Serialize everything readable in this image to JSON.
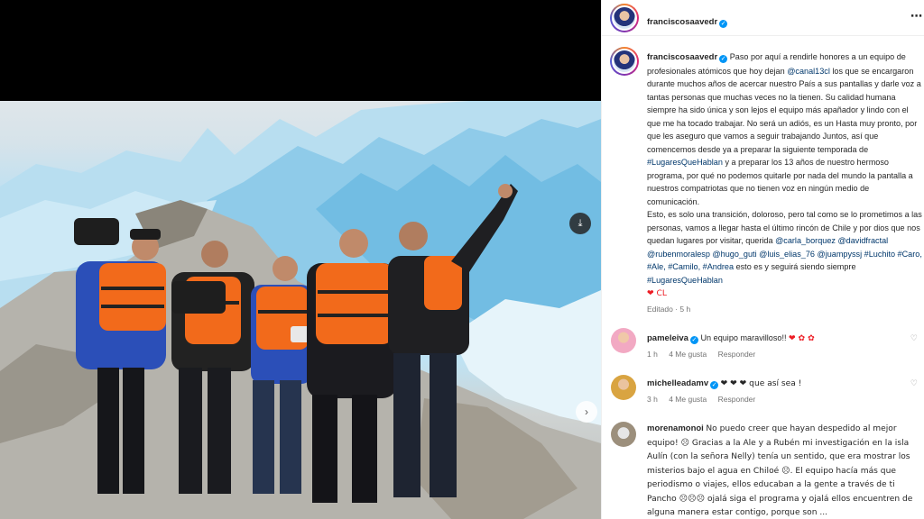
{
  "post": {
    "username": "franciscosaavedr",
    "more_icon": "⋯",
    "caption_parts": {
      "p1a": "Paso por aquí a rendirle honores a un equipo de profesionales atómicos que hoy dejan ",
      "mention_canal": "@canal13cl",
      "p1b": " los que se encargaron durante muchos años de acercar nuestro País a sus pantallas y darle voz a tantas personas que muchas veces no la tienen. Su calidad humana siempre ha sido única y son lejos el equipo más apañador y lindo con el que me ha tocado trabajar. No será un adiós, es un Hasta muy pronto, por que les aseguro que vamos a seguir trabajando Juntos, así que comencemos desde ya a preparar la siguiente temporada de ",
      "hashtag1": "#LugaresQueHablan",
      "p1c": " y a preparar los 13 años de nuestro hermoso programa, por qué no podemos quitarle por nada del mundo la pantalla a nuestros compatriotas que no tienen voz en ningún medio de comunicación.",
      "p2a": "Esto, es solo una transición, doloroso, pero tal como se lo prometimos a las personas, vamos a llegar hasta el último rincón de Chile y por dios que nos quedan lugares por visitar, querida ",
      "tags": "@carla_borquez @davidfractal @rubenmoralesp @hugo_guti @luis_elias_76 @juampyssj #Luchito #Caro, #Ale, #Camilo, #Andrea",
      "p2b": " esto es y seguirá siendo siempre ",
      "hashtag2": "#LugaresQueHablan",
      "flag": "❤ CL"
    },
    "edited": "Editado · 5 h"
  },
  "comments": [
    {
      "username": "pameleiva",
      "verified": true,
      "text": "Un equipo maravilloso!!",
      "emoji": "❤ ✿ ✿",
      "time": "1 h",
      "likes": "4 Me gusta",
      "reply": "Responder"
    },
    {
      "username": "michelleadamv",
      "verified": true,
      "text": "❤ ❤ ❤ que así sea !",
      "time": "3 h",
      "likes": "4 Me gusta",
      "reply": "Responder"
    },
    {
      "username": "morenamonoi",
      "verified": false,
      "text": "No puedo creer que hayan despedido al mejor equipo! ☹ Gracias a la Ale y a Rubén mi investigación en la isla Aulín (con la señora Nelly) tenía un sentido, que era mostrar los misterios bajo el agua en Chiloé ☹. El equipo hacía más que periodismo o viajes, ellos educaban a la gente a través de ti Pancho ☹☹☹ ojalá siga el programa y ojalá ellos encuentren de alguna manera estar contigo, porque son ..."
    }
  ],
  "icons": {
    "download": "download-icon",
    "next": "chevron-right-icon",
    "verified": "verified-badge-icon",
    "heart": "heart-icon"
  },
  "colors": {
    "link": "#00376b",
    "verified": "#0095f6",
    "muted": "#737373",
    "ice": "#a7d7ef",
    "lifejacket": "#f26a1b"
  }
}
